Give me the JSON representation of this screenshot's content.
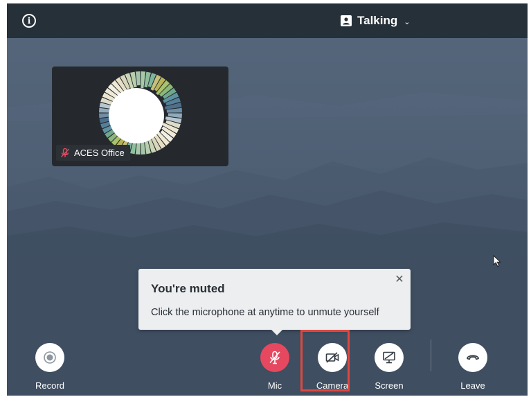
{
  "header": {
    "info_icon": "info-icon",
    "view_label": "Talking",
    "view_icon": "person-frame-icon",
    "chevron_icon": "chevron-down-icon"
  },
  "participant": {
    "name": "ACES Office",
    "status_icon": "mic-off-icon",
    "muted": true
  },
  "tooltip": {
    "title": "You're muted",
    "body": "Click the microphone at anytime to unmute yourself",
    "close_icon": "close-icon"
  },
  "controls": {
    "record": {
      "label": "Record",
      "icon": "record-icon"
    },
    "mic": {
      "label": "Mic",
      "icon": "mic-off-icon",
      "muted": true
    },
    "camera": {
      "label": "Camera",
      "icon": "camera-off-icon",
      "highlighted": true
    },
    "screen": {
      "label": "Screen",
      "icon": "screen-share-off-icon"
    },
    "leave": {
      "label": "Leave",
      "icon": "hang-up-icon"
    }
  },
  "colors": {
    "topbar": "#263038",
    "background": "#4f6075",
    "tile": "#25292e",
    "mic_muted": "#e6485f",
    "highlight_box": "#e0473f",
    "tooltip_bg": "#eceeef"
  }
}
